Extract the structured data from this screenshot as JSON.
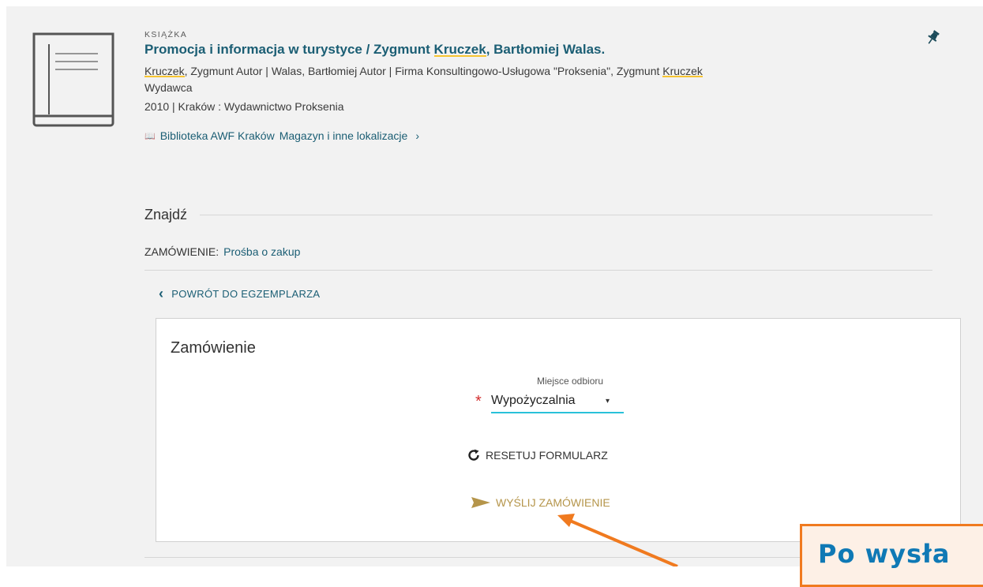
{
  "record": {
    "type_label": "KSIĄŻKA",
    "title_pre": "Promocja i informacja w turystyce / Zygmunt ",
    "title_hl": "Kruczek",
    "title_post": ", Bartłomiej Walas.",
    "authors_hl1": "Kruczek",
    "authors_mid": ", Zygmunt Autor | Walas, Bartłomiej Autor | Firma Konsultingowo-Usługowa \"Proksenia\", Zygmunt ",
    "authors_hl2": "Kruczek",
    "authors_post": " Wydawca",
    "pub_info": "2010 | Kraków : Wydawnictwo Proksenia",
    "library": "Biblioteka AWF Kraków",
    "location": "Magazyn i inne lokalizacje",
    "location_chevron": "›",
    "library_icon": "library-book-icon",
    "pin_icon": "pin-icon"
  },
  "find": {
    "label": "Znajdź"
  },
  "order": {
    "label": "ZAMÓWIENIE:",
    "value": "Prośba o zakup"
  },
  "back_link": {
    "chevron": "‹",
    "label": "POWRÓT DO EGZEMPLARZA"
  },
  "form": {
    "title": "Zamówienie",
    "pickup_label": "Miejsce odbioru",
    "required_mark": "*",
    "pickup_value": "Wypożyczalnia",
    "caret": "▾",
    "reset_label": "RESETUJ FORMULARZ",
    "send_label": "WYŚLIJ ZAMÓWIENIE"
  },
  "callout": {
    "text": "Po wysła"
  },
  "colors": {
    "link": "#1b5e74",
    "highlight": "#f7c531",
    "send": "#b5954a",
    "focus_underline": "#29c1d9",
    "callout_border": "#f07a1f",
    "callout_text": "#0f79b5"
  }
}
